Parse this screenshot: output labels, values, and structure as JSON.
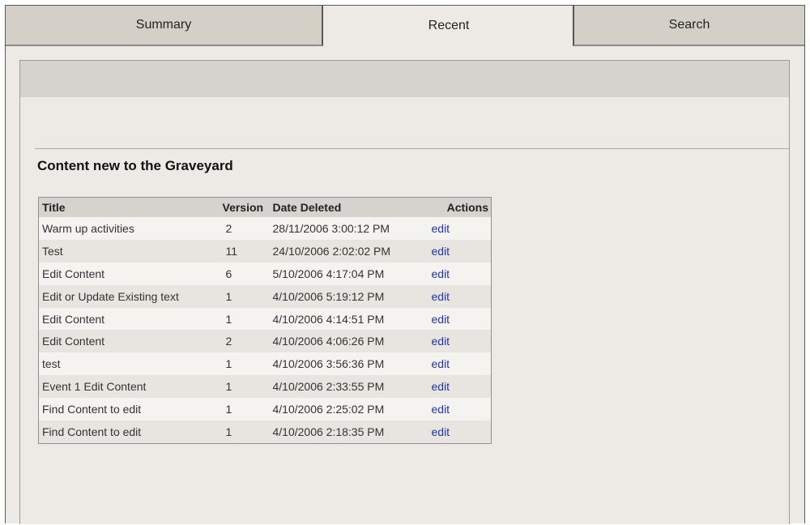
{
  "tabs": [
    {
      "label": "Summary",
      "active": false
    },
    {
      "label": "Recent",
      "active": true
    },
    {
      "label": "Search",
      "active": false
    }
  ],
  "section_title": "Content new to the Graveyard",
  "table": {
    "headers": {
      "title": "Title",
      "version": "Version",
      "date_deleted": "Date Deleted",
      "actions": "Actions"
    },
    "rows": [
      {
        "title": "Warm up activities",
        "version": "2",
        "date_deleted": "28/11/2006 3:00:12 PM",
        "action": "edit"
      },
      {
        "title": "Test",
        "version": "11",
        "date_deleted": "24/10/2006 2:02:02 PM",
        "action": "edit"
      },
      {
        "title": "Edit Content",
        "version": "6",
        "date_deleted": "5/10/2006 4:17:04 PM",
        "action": "edit"
      },
      {
        "title": "Edit or Update Existing text",
        "version": "1",
        "date_deleted": "4/10/2006 5:19:12 PM",
        "action": "edit"
      },
      {
        "title": "Edit Content",
        "version": "1",
        "date_deleted": "4/10/2006 4:14:51 PM",
        "action": "edit"
      },
      {
        "title": "Edit Content",
        "version": "2",
        "date_deleted": "4/10/2006 4:06:26 PM",
        "action": "edit"
      },
      {
        "title": "test",
        "version": "1",
        "date_deleted": "4/10/2006 3:56:36 PM",
        "action": "edit"
      },
      {
        "title": "Event 1 Edit Content",
        "version": "1",
        "date_deleted": "4/10/2006 2:33:55 PM",
        "action": "edit"
      },
      {
        "title": "Find Content to edit",
        "version": "1",
        "date_deleted": "4/10/2006 2:25:02 PM",
        "action": "edit"
      },
      {
        "title": "Find Content to edit",
        "version": "1",
        "date_deleted": "4/10/2006 2:18:35 PM",
        "action": "edit"
      }
    ]
  },
  "colors": {
    "window_background": "#edeae5",
    "header_band": "#d6d3ce",
    "inactive_tab": "#d4d0c8",
    "link": "#2233aa"
  }
}
